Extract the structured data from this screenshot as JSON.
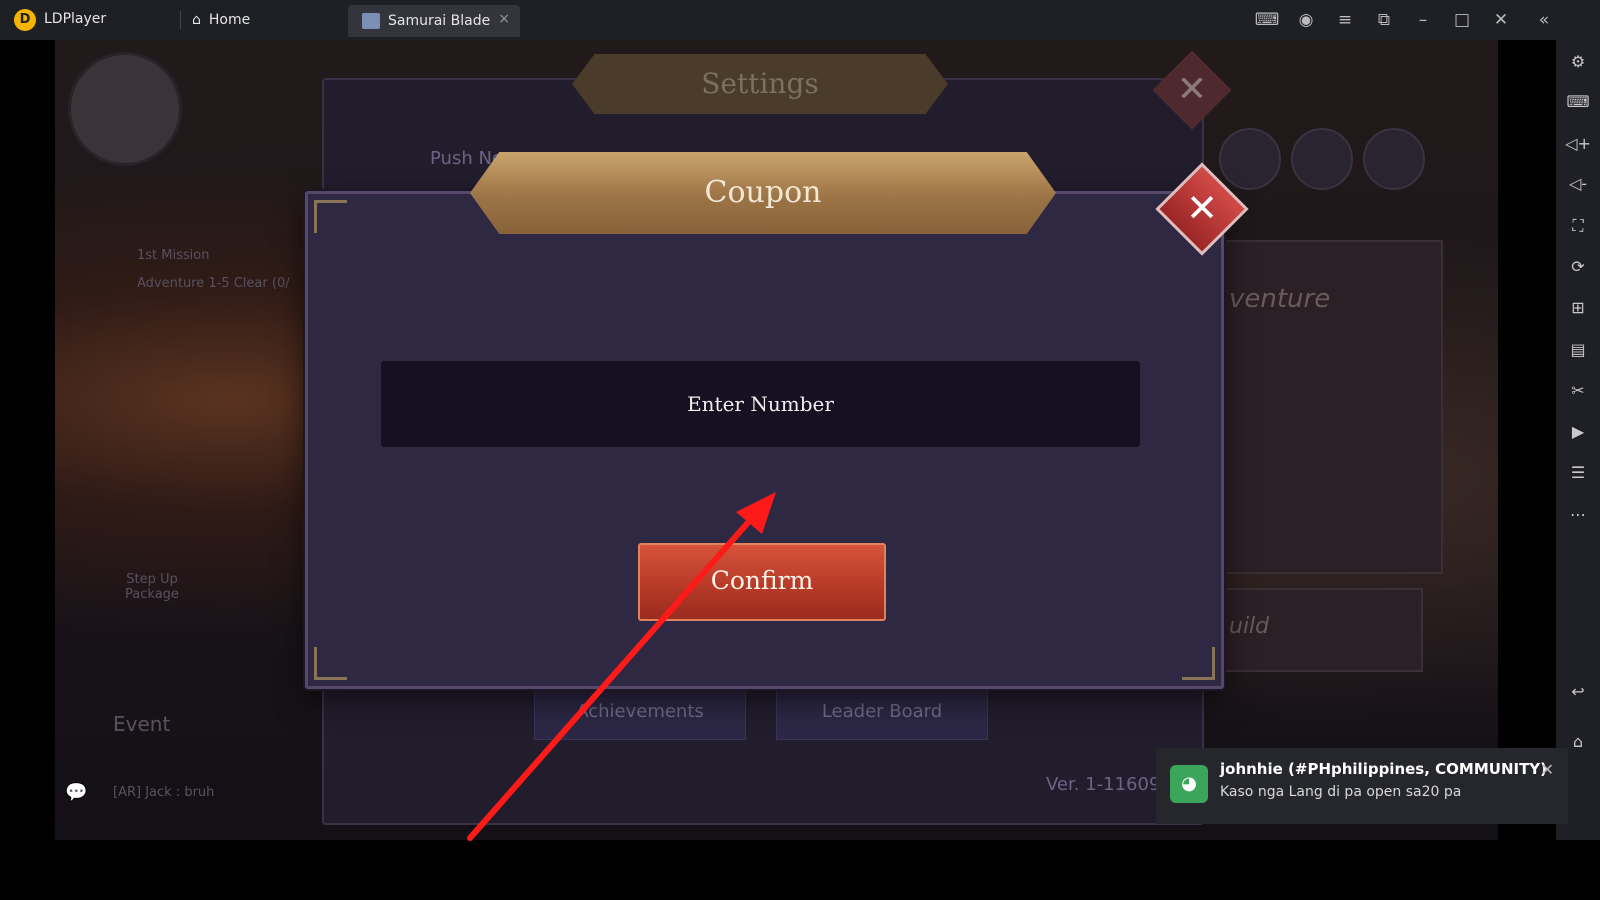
{
  "titlebar": {
    "app_name": "LDPlayer",
    "home_tab": "Home",
    "game_tab": "Samurai Blade",
    "controls": [
      "gamepad-icon",
      "account-icon",
      "menu-icon",
      "restore-icon",
      "minimize-icon",
      "maximize-icon",
      "close-icon",
      "collapse-icon"
    ]
  },
  "sidebar": {
    "icons": [
      "settings-icon",
      "keyboard-icon",
      "volume-up-icon",
      "volume-down-icon",
      "screenshot-icon",
      "sync-icon",
      "add-window-icon",
      "apk-icon",
      "scissors-icon",
      "record-icon",
      "operations-icon",
      "more-icon",
      "back-icon",
      "home-icon"
    ]
  },
  "game": {
    "background": {
      "mission_label": "1st Mission",
      "mission_desc": "Adventure 1-5 Clear (0/",
      "step_up": "Step Up Package",
      "event": "Event",
      "chat": "[AR] Jack : bruh",
      "adventure": "venture",
      "guild": "uild"
    },
    "settings": {
      "title": "Settings",
      "push_label": "Push No",
      "tab_achievements": "Achievements",
      "tab_leaderboard": "Leader Board",
      "version": "Ver. 1-11609"
    },
    "coupon": {
      "title": "Coupon",
      "input_placeholder": "Enter Number",
      "confirm_label": "Confirm"
    }
  },
  "toast": {
    "title": "johnhie (#PHphilippines, COMMUNITY)",
    "message": "Kaso nga Lang di pa open sa20 pa"
  },
  "colors": {
    "arrow": "#ff1a1a",
    "confirm": "#c0412c",
    "modal_bg": "#2e2843",
    "banner_gold": "#a27a4a"
  }
}
